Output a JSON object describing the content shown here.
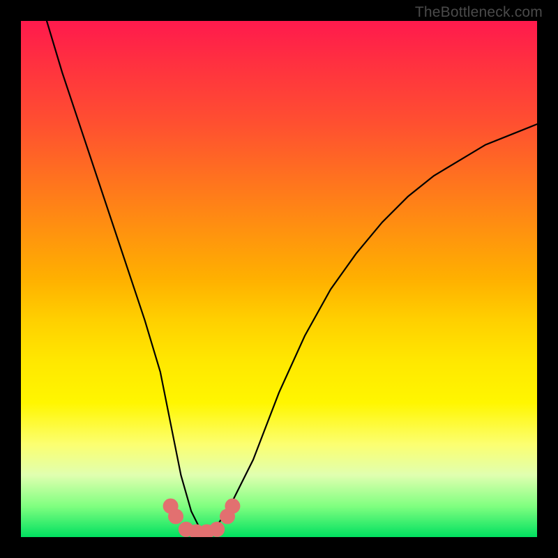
{
  "watermark": "TheBottleneck.com",
  "chart_data": {
    "type": "line",
    "title": "",
    "xlabel": "",
    "ylabel": "",
    "xlim": [
      0,
      100
    ],
    "ylim": [
      0,
      100
    ],
    "series": [
      {
        "name": "bottleneck-curve",
        "x": [
          5,
          8,
          12,
          16,
          20,
          24,
          27,
          29,
          31,
          33,
          35,
          37,
          40,
          45,
          50,
          55,
          60,
          65,
          70,
          75,
          80,
          85,
          90,
          95,
          100
        ],
        "y": [
          100,
          90,
          78,
          66,
          54,
          42,
          32,
          22,
          12,
          5,
          1,
          1,
          5,
          15,
          28,
          39,
          48,
          55,
          61,
          66,
          70,
          73,
          76,
          78,
          80
        ]
      }
    ],
    "markers": {
      "name": "highlight-dots",
      "color": "#e27070",
      "points": [
        {
          "x": 29,
          "y": 6
        },
        {
          "x": 30,
          "y": 4
        },
        {
          "x": 32,
          "y": 1.5
        },
        {
          "x": 34,
          "y": 1
        },
        {
          "x": 36,
          "y": 1
        },
        {
          "x": 38,
          "y": 1.5
        },
        {
          "x": 40,
          "y": 4
        },
        {
          "x": 41,
          "y": 6
        }
      ]
    },
    "background_gradient": {
      "top": "#ff1a4d",
      "mid": "#ffe800",
      "bottom": "#00e060"
    }
  }
}
